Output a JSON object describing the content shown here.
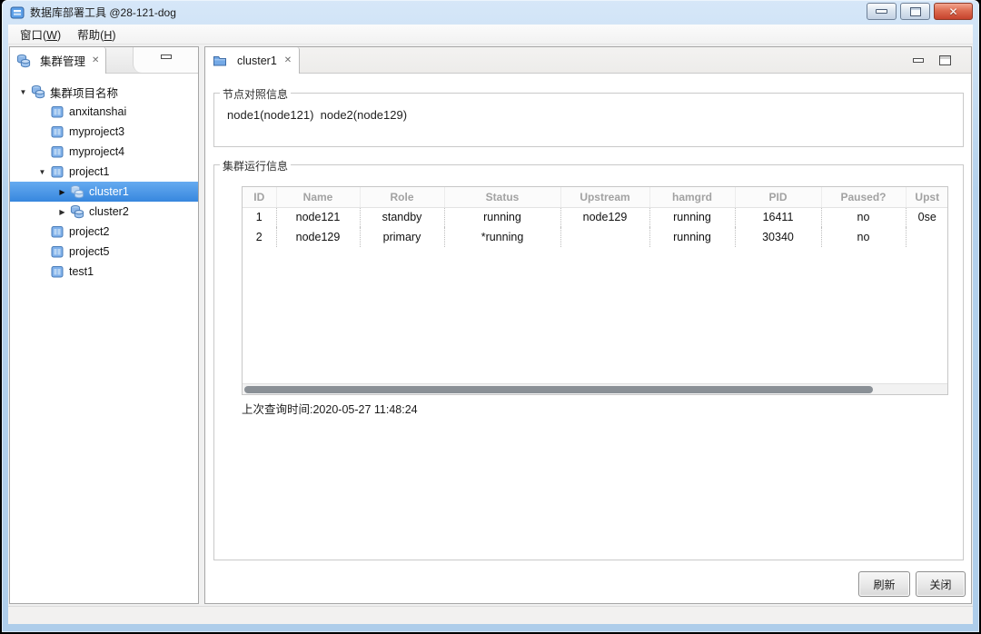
{
  "window": {
    "title": "数据库部署工具 @28-121-dog"
  },
  "menubar": {
    "items": [
      {
        "pre": "窗口(",
        "mnemonic": "W",
        "post": ")"
      },
      {
        "pre": "帮助(",
        "mnemonic": "H",
        "post": ")"
      }
    ]
  },
  "explorer": {
    "tab_label": "集群管理",
    "tree": [
      {
        "label": "集群项目名称"
      },
      {
        "label": "anxitanshai"
      },
      {
        "label": "myproject3"
      },
      {
        "label": "myproject4"
      },
      {
        "label": "project1"
      },
      {
        "label": "cluster1"
      },
      {
        "label": "cluster2"
      },
      {
        "label": "project2"
      },
      {
        "label": "project5"
      },
      {
        "label": "test1"
      }
    ]
  },
  "editor": {
    "tab_label": "cluster1",
    "node_info": {
      "group_title": "节点对照信息",
      "content": "node1(node121)  node2(node129)"
    },
    "cluster_info": {
      "group_title": "集群运行信息",
      "table": {
        "columns": [
          "ID",
          "Name",
          "Role",
          "Status",
          "Upstream",
          "hamgrd",
          "PID",
          "Paused?",
          "Upst"
        ],
        "rows": [
          [
            "1",
            "node121",
            "standby",
            "running",
            "node129",
            "running",
            "16411",
            "no",
            "0se"
          ],
          [
            "2",
            "node129",
            "primary",
            "*running",
            "",
            "running",
            "30340",
            "no",
            ""
          ]
        ]
      },
      "last_query": "上次查询时间:2020-05-27 11:48:24"
    },
    "buttons": {
      "refresh": "刷新",
      "close": "关闭"
    }
  },
  "colors": {
    "selection_blue": "#3787de",
    "frame_blue": "#b4d1ec",
    "close_button_red": "#c6432d"
  }
}
